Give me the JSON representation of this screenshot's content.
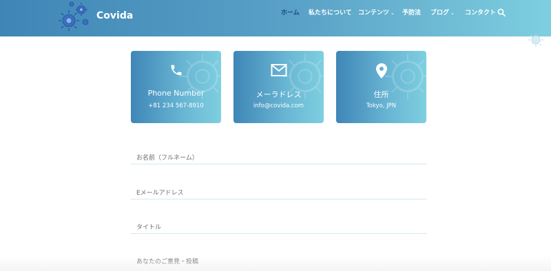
{
  "brand": {
    "name": "Covida",
    "logo_icon": "virus-icon"
  },
  "nav": {
    "items": [
      {
        "label": "ホーム",
        "active": true,
        "dropdown": false
      },
      {
        "label": "私たちについて",
        "active": false,
        "dropdown": false
      },
      {
        "label": "コンテンツ",
        "active": false,
        "dropdown": true
      },
      {
        "label": "予防法",
        "active": false,
        "dropdown": false
      },
      {
        "label": "ブログ",
        "active": false,
        "dropdown": true
      },
      {
        "label": "コンタクト",
        "active": false,
        "dropdown": false
      }
    ],
    "search_icon": "search-icon"
  },
  "contact_cards": [
    {
      "icon": "phone-icon",
      "title": "Phone Number",
      "value": "+81 234 567-8910"
    },
    {
      "icon": "envelope-icon",
      "title": "メーラドレス",
      "value": "info@covida.com"
    },
    {
      "icon": "map-pin-icon",
      "title": "住所",
      "value": "Tokyo, JPN"
    }
  ],
  "form": {
    "fullname_placeholder": "お名前（フルネーム）",
    "email_placeholder": "Eメールアドレス",
    "title_placeholder": "タイトル",
    "message_placeholder": "あなたのご意見・投稿"
  },
  "colors": {
    "header_gradient_start": "#3f86b7",
    "header_gradient_end": "#7ecfe0",
    "nav_active": "#1a4a8a",
    "field_border": "#d3e8f2"
  }
}
